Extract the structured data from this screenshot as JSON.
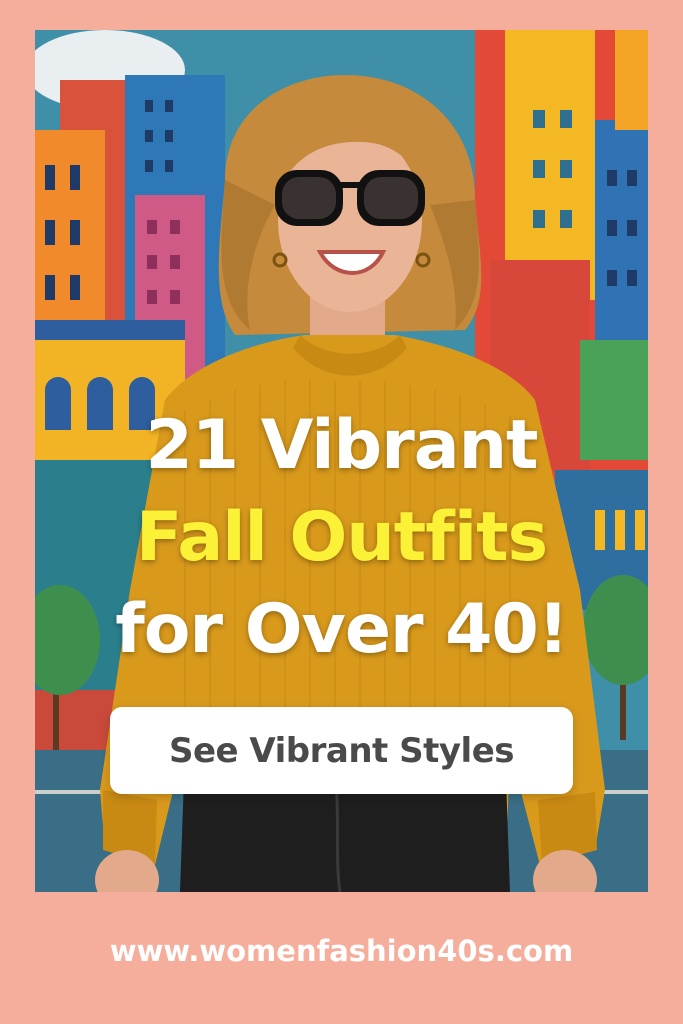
{
  "headline": {
    "line1": "21 Vibrant",
    "line2": "Fall Outfits",
    "line3": "for Over 40!"
  },
  "cta": {
    "label": "See Vibrant Styles"
  },
  "footer": {
    "url": "www.womenfashion40s.com"
  },
  "colors": {
    "page_background": "#F6AE9C",
    "headline_white": "#FFFFFF",
    "headline_accent": "#FBF137",
    "button_background": "#FFFFFF",
    "button_text": "#4A4A4A",
    "sweater": "#D99A1C"
  }
}
